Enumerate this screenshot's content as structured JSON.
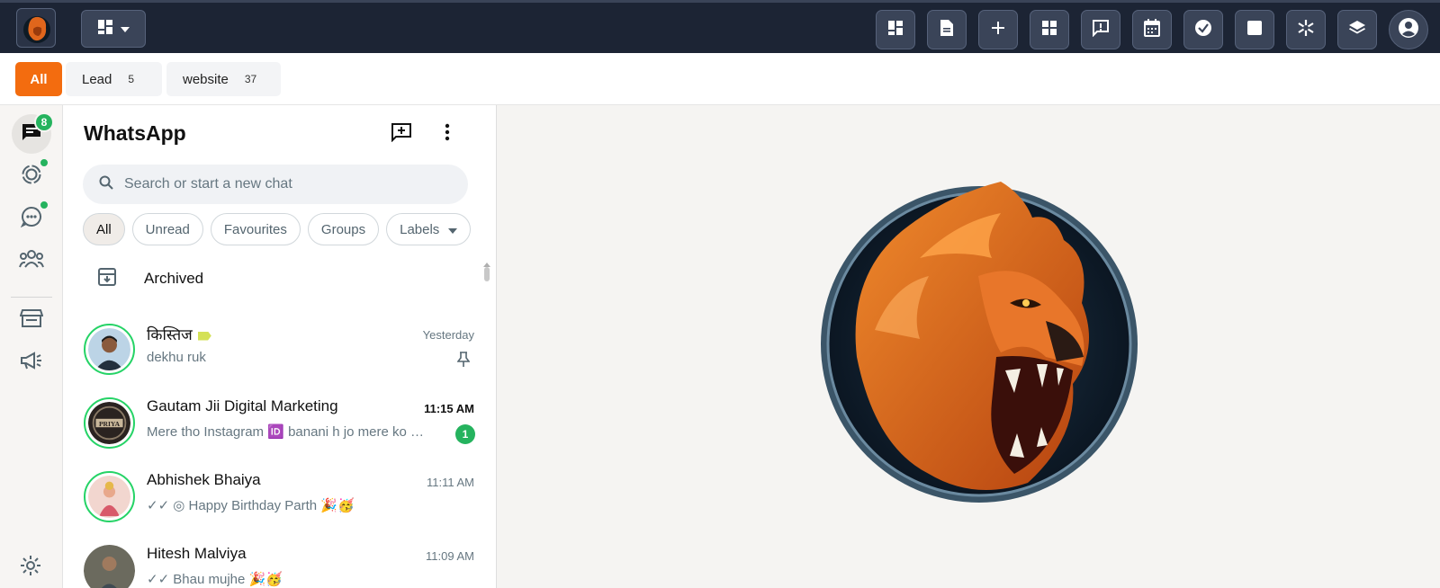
{
  "topbar": {
    "logo_name": "lion-logo",
    "layout_button_icon": "dashboard-grid-icon",
    "tools": [
      {
        "icon": "dashboard-icon",
        "name": "dashboard-button"
      },
      {
        "icon": "document-icon",
        "name": "document-button"
      },
      {
        "icon": "plus-icon",
        "name": "add-button"
      },
      {
        "icon": "apps-grid-icon",
        "name": "apps-button"
      },
      {
        "icon": "feedback-icon",
        "name": "feedback-button"
      },
      {
        "icon": "calendar-icon",
        "name": "calendar-button"
      },
      {
        "icon": "check-circle-icon",
        "name": "tasks-button"
      },
      {
        "icon": "square-icon",
        "name": "square-button"
      },
      {
        "icon": "asterisk-icon",
        "name": "asterisk-button"
      },
      {
        "icon": "layers-icon",
        "name": "layers-button"
      },
      {
        "icon": "account-circle-icon",
        "name": "account-button"
      }
    ]
  },
  "filters": [
    {
      "label": "All",
      "count": "",
      "active": true
    },
    {
      "label": "Lead",
      "count": "5",
      "active": false
    },
    {
      "label": "website",
      "count": "37",
      "active": false
    }
  ],
  "rail": {
    "chats_badge": "8",
    "items": [
      "chats-icon",
      "status-icon",
      "channels-icon",
      "communities-icon",
      "store-icon",
      "megaphone-icon",
      "settings-icon"
    ],
    "accent": "#25b35e"
  },
  "panel": {
    "title": "WhatsApp",
    "search_placeholder": "Search or start a new chat",
    "pills": [
      "All",
      "Unread",
      "Favourites",
      "Groups",
      "Labels"
    ],
    "archived_label": "Archived",
    "chats": [
      {
        "name": "किस्तिज",
        "time": "Yesterday",
        "message": "dekhu ruk",
        "pinned": true,
        "unread": ""
      },
      {
        "name": "Gautam Jii Digital Marketing",
        "time": "11:15 AM",
        "message": "Mere tho Instagram 🆔 banani h jo mere ko …",
        "pinned": false,
        "unread": "1"
      },
      {
        "name": "Abhishek Bhaiya",
        "time": "11:11 AM",
        "message": "✓✓ ◎ Happy Birthday Parth 🎉🥳",
        "pinned": false,
        "unread": ""
      },
      {
        "name": "Hitesh Malviya",
        "time": "11:09 AM",
        "message": "✓✓ Bhau mujhe 🎉🥳",
        "pinned": false,
        "unread": ""
      }
    ]
  },
  "colors": {
    "topbar": "#1c2434",
    "accent_orange": "#f36c0f",
    "online_ring": "#25d366"
  }
}
